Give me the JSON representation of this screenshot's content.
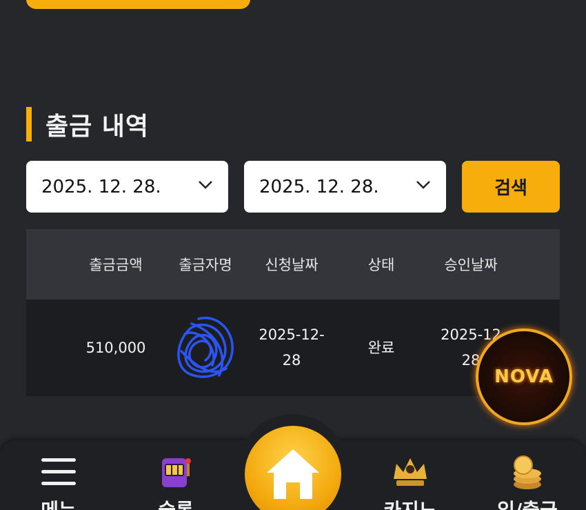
{
  "section": {
    "title": "출금 내역"
  },
  "filter": {
    "from_date": "2025. 12. 28.",
    "to_date": "2025. 12. 28.",
    "search_label": "검색"
  },
  "table": {
    "headers": [
      "출금금액",
      "출금자명",
      "신청날짜",
      "상태",
      "승인날짜"
    ],
    "rows": [
      {
        "amount": "510,000",
        "name": "",
        "request_date_line1": "2025-12-",
        "request_date_line2": "28",
        "status": "완료",
        "approve_date_line1": "2025-12",
        "approve_date_line2": "28"
      }
    ]
  },
  "badge": {
    "logo_text": "NOVA"
  },
  "nav": {
    "menu": "메뉴",
    "slot": "슬롯",
    "casino": "카지노",
    "bank": "입/출금",
    "home_icon": "home-icon"
  },
  "colors": {
    "accent": "#f7ad0b",
    "background": "#26272b",
    "header_row": "#34353a",
    "data_row": "#1c1d20"
  }
}
